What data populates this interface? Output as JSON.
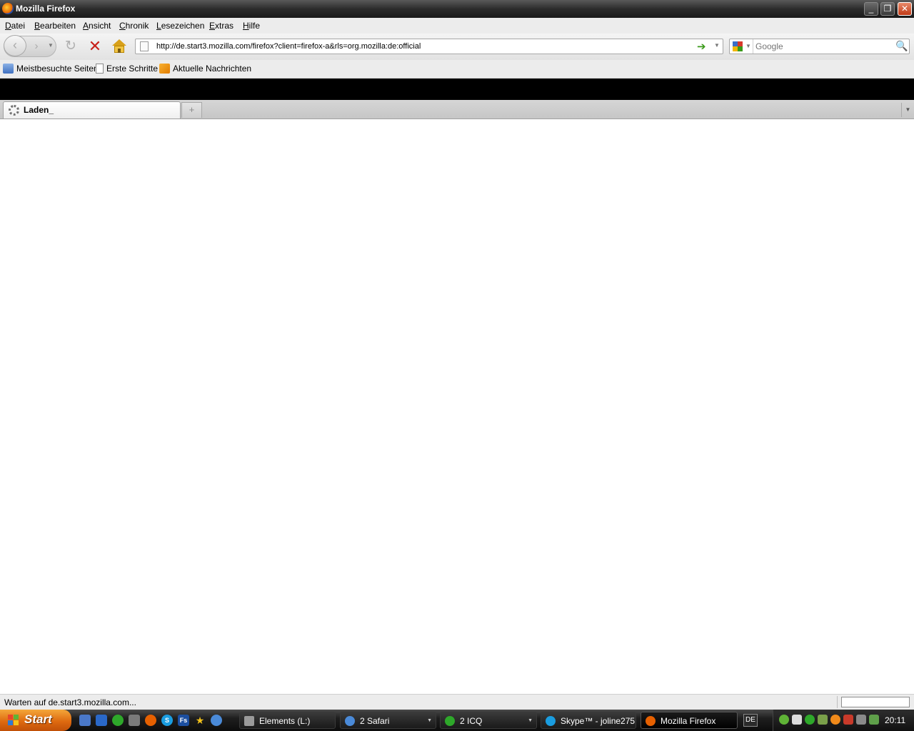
{
  "window": {
    "title": "Mozilla Firefox",
    "min_glyph": "_",
    "max_glyph": "❐",
    "close_glyph": "✕"
  },
  "menu": [
    "Datei",
    "Bearbeiten",
    "Ansicht",
    "Chronik",
    "Lesezeichen",
    "Extras",
    "Hilfe"
  ],
  "nav": {
    "back_glyph": "‹",
    "forward_glyph": "›",
    "dropdown_glyph": "▼",
    "reload_glyph": "↻",
    "stop_glyph": "✕",
    "url": "http://de.start3.mozilla.com/firefox?client=firefox-a&rls=org.mozilla:de:official",
    "go_glyph": "➔"
  },
  "search": {
    "placeholder": "Google",
    "button_glyph": "🔍"
  },
  "bookmarks": [
    "Meistbesuchte Seiten",
    "Erste Schritte",
    "Aktuelle Nachrichten"
  ],
  "tabs": {
    "active_label": "Laden_",
    "new_tab_glyph": "+",
    "all_tabs_glyph": "▼"
  },
  "status": {
    "text": "Warten auf de.start3.mozilla.com..."
  },
  "taskbar": {
    "start_label": "Start",
    "quicklaunch": [
      "",
      "",
      "",
      "",
      "",
      "S",
      "Fs",
      "★",
      ""
    ],
    "buttons": [
      {
        "label": "Elements (L:)",
        "icon": "drive-icon"
      },
      {
        "label": "2 Safari",
        "icon": "safari-icon"
      },
      {
        "label": "2 ICQ",
        "icon": "icq-icon"
      },
      {
        "label": "Skype™ - joline275",
        "icon": "skype-icon"
      },
      {
        "label": "Mozilla Firefox",
        "icon": "firefox-icon"
      }
    ],
    "language": "DE",
    "clock": "20:11"
  },
  "colors": {
    "accent_orange": "#de6a10",
    "stop_red": "#c8201a",
    "go_green": "#3a9a1a"
  }
}
